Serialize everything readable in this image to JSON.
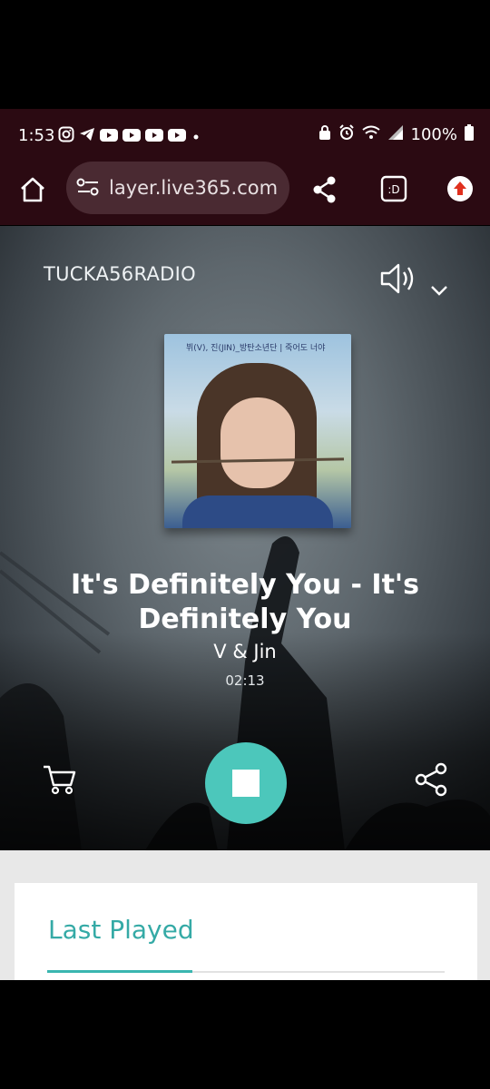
{
  "status_bar": {
    "time": "1:53",
    "battery": "100%"
  },
  "browser": {
    "url": "layer.live365.com"
  },
  "player": {
    "station": "TUCKA56RADIO",
    "album_cover_text": "뷔(V), 진(JIN)_방탄소년단 | 죽어도 너야",
    "song_title": "It's Definitely You - It's Definitely You",
    "artist": "V & Jin",
    "elapsed": "02:13",
    "accent_color": "#4cc7bb"
  },
  "last_played": {
    "heading": "Last Played"
  }
}
